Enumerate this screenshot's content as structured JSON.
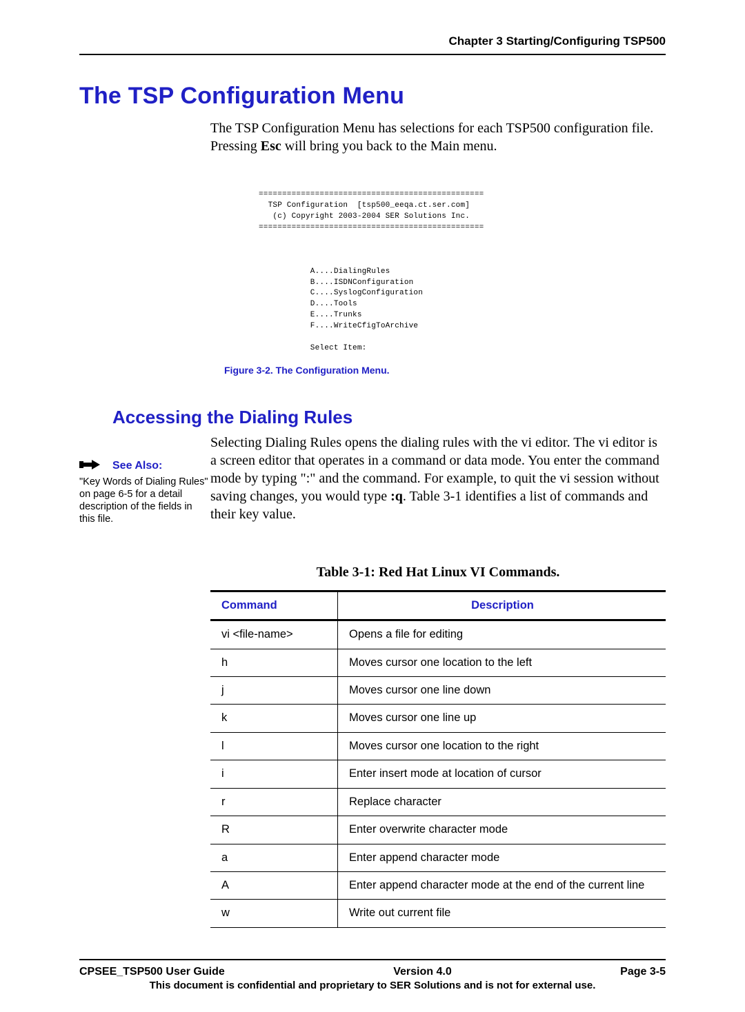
{
  "header": {
    "chapterTitle": "Chapter 3 Starting/Configuring TSP500"
  },
  "section": {
    "title": "The TSP Configuration Menu",
    "para_pre": "The TSP Configuration Menu has selections for each TSP500 configuration file.  Pressing ",
    "para_bold": "Esc",
    "para_post": " will bring you back to the Main menu."
  },
  "terminal": {
    "line1": "================================================",
    "line2": "  TSP Configuration  [tsp500_eeqa.ct.ser.com]",
    "line3": "   (c) Copyright 2003-2004 SER Solutions Inc.",
    "line4": "================================================",
    "opt1": "           A....DialingRules",
    "opt2": "           B....ISDNConfiguration",
    "opt3": "           C....SyslogConfiguration",
    "opt4": "           D....Tools",
    "opt5": "           E....Trunks",
    "opt6": "           F....WriteCfigToArchive",
    "sel": "           Select Item:"
  },
  "figCaption": "Figure 3-2. The Configuration Menu.",
  "subsection": {
    "title": "Accessing the Dialing Rules",
    "para_pre": "Selecting Dialing Rules opens the dialing rules with the vi editor. The vi editor is a screen editor that operates in a command or data mode. You enter the command mode by typing \":\" and the command. For example, to quit the vi session without saving changes, you would type ",
    "para_bold": ":q",
    "para_post": ". Table 3-1 identifies a list of commands and their key value."
  },
  "seeAlso": {
    "label": "See Also:",
    "body": "\"Key Words of Dialing Rules\" on page 6-5 for a detail description of the fields in this file."
  },
  "table": {
    "caption": "Table 3-1: Red Hat Linux VI Commands.",
    "head": {
      "c1": "Command",
      "c2": "Description"
    },
    "rows": [
      {
        "cmd": "vi <file-name>",
        "desc": "Opens a file for editing"
      },
      {
        "cmd": "h",
        "desc": "Moves cursor one location to the left"
      },
      {
        "cmd": "j",
        "desc": "Moves cursor one line down"
      },
      {
        "cmd": "k",
        "desc": "Moves cursor one line up"
      },
      {
        "cmd": "l",
        "desc": "Moves cursor one location to the right"
      },
      {
        "cmd": "i",
        "desc": "Enter insert mode at location of cursor"
      },
      {
        "cmd": "r",
        "desc": "Replace character"
      },
      {
        "cmd": "R",
        "desc": "Enter overwrite character mode"
      },
      {
        "cmd": "a",
        "desc": "Enter append character mode"
      },
      {
        "cmd": "A",
        "desc": "Enter append character mode at the end of the current line"
      },
      {
        "cmd": "w",
        "desc": "Write out current file"
      }
    ]
  },
  "footer": {
    "left": "CPSEE_TSP500 User Guide",
    "center": "Version 4.0",
    "right": "Page 3-5",
    "note": "This document is confidential and proprietary to SER Solutions and is not for external use."
  }
}
